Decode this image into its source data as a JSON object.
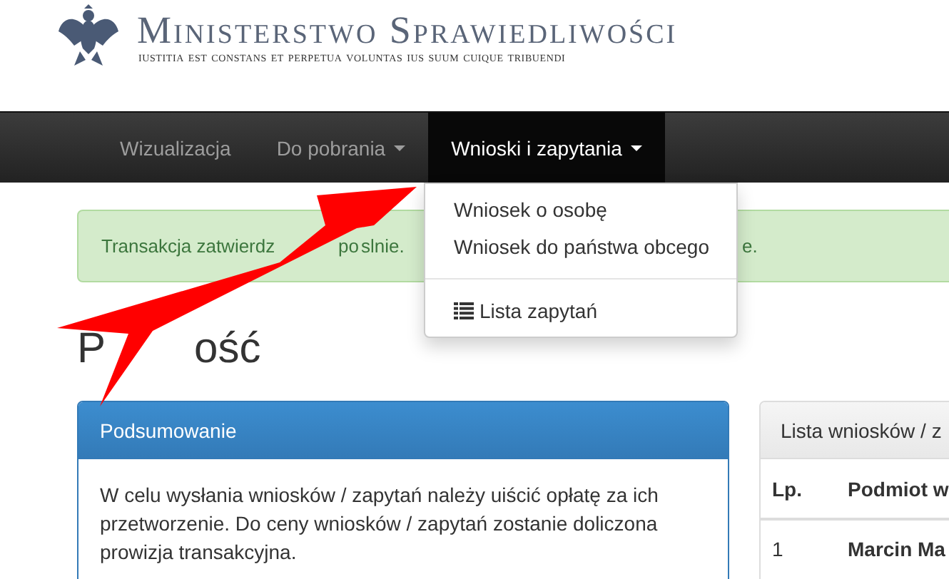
{
  "header": {
    "title": "Ministerstwo Sprawiedliwości",
    "motto": "iustitia est constans et perpetua voluntas ius suum cuique tribuendi"
  },
  "nav": [
    {
      "label": "Wizualizacja",
      "selected": false,
      "dropdown": false
    },
    {
      "label": "Do pobrania",
      "selected": false,
      "dropdown": true
    },
    {
      "label": "Wnioski i zapytania",
      "selected": true,
      "dropdown": true
    }
  ],
  "menu": [
    {
      "kind": "link",
      "label": "Wniosek o osobę"
    },
    {
      "kind": "link",
      "label": "Wniosek do państwa obcego"
    },
    {
      "kind": "divider"
    },
    {
      "kind": "list",
      "label": "Lista zapytań"
    }
  ],
  "alert": {
    "parts": [
      "Transakcja zatwierdz",
      "po",
      "slnie."
    ],
    "tail": "e."
  },
  "heading": {
    "parts": [
      "P",
      "ość"
    ]
  },
  "summary": {
    "title": "Podsumowanie",
    "text": "W celu wysłania wniosków / zapytań należy uiścić opłatę za ich przetworzenie. Do ceny wniosków / zapytań zostanie doliczona prowizja transakcyjna."
  },
  "list_panel": {
    "title": "Lista wniosków / z",
    "columns": [
      "Lp.",
      "Podmiot w"
    ],
    "rows": [
      [
        "1",
        "Marcin Ma"
      ]
    ]
  }
}
